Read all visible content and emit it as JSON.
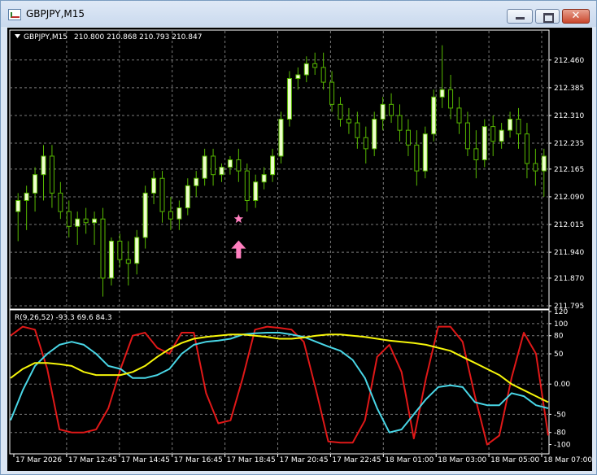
{
  "window": {
    "title": "GBPJPY,M15",
    "close_glyph": "✕",
    "icons": {
      "app": "chart-app-icon",
      "minimize": "minimize-icon",
      "maximize": "maximize-icon",
      "close": "close-icon"
    }
  },
  "chart_header": {
    "symbol_text": "GBPJPY,M15",
    "ohlc_text": "210.800 210.868 210.793 210.847",
    "dropdown_icon": "triangle-down-icon"
  },
  "oscillator_header": {
    "text": "R(9,26,52) -93.3 69.6 84.3"
  },
  "colors": {
    "background": "#000000",
    "grid": "#7a7a7a",
    "candle_bull": "#eeffcc",
    "candle_bear": "#000000",
    "wick": "#57b800",
    "marker": "#ff7fbf",
    "series_red": "#e01818",
    "series_cyan": "#49d6e6",
    "series_yellow": "#f5f50a"
  },
  "chart_data": [
    {
      "type": "candlestick",
      "title": "GBPJPY,M15",
      "y_ticks": [
        "212.460",
        "212.385",
        "212.310",
        "212.235",
        "212.165",
        "212.090",
        "212.015",
        "211.940",
        "211.870",
        "211.795"
      ],
      "ylim": [
        211.795,
        212.53
      ],
      "candles": [
        {
          "o": 212.05,
          "h": 212.1,
          "l": 211.97,
          "c": 212.08
        },
        {
          "o": 212.08,
          "h": 212.12,
          "l": 212.0,
          "c": 212.1
        },
        {
          "o": 212.1,
          "h": 212.17,
          "l": 212.05,
          "c": 212.15
        },
        {
          "o": 212.15,
          "h": 212.23,
          "l": 212.08,
          "c": 212.2
        },
        {
          "o": 212.2,
          "h": 212.23,
          "l": 212.06,
          "c": 212.1
        },
        {
          "o": 212.1,
          "h": 212.13,
          "l": 212.03,
          "c": 212.05
        },
        {
          "o": 212.05,
          "h": 212.08,
          "l": 211.98,
          "c": 212.01
        },
        {
          "o": 212.01,
          "h": 212.05,
          "l": 211.96,
          "c": 212.03
        },
        {
          "o": 212.03,
          "h": 212.06,
          "l": 211.99,
          "c": 212.02
        },
        {
          "o": 212.02,
          "h": 212.05,
          "l": 211.96,
          "c": 212.03
        },
        {
          "o": 212.03,
          "h": 212.06,
          "l": 211.82,
          "c": 211.87
        },
        {
          "o": 211.87,
          "h": 211.98,
          "l": 211.85,
          "c": 211.97
        },
        {
          "o": 211.97,
          "h": 211.99,
          "l": 211.9,
          "c": 211.92
        },
        {
          "o": 211.92,
          "h": 211.97,
          "l": 211.85,
          "c": 211.91
        },
        {
          "o": 211.91,
          "h": 212.0,
          "l": 211.88,
          "c": 211.98
        },
        {
          "o": 211.98,
          "h": 212.12,
          "l": 211.95,
          "c": 212.1
        },
        {
          "o": 212.1,
          "h": 212.16,
          "l": 212.07,
          "c": 212.14
        },
        {
          "o": 212.14,
          "h": 212.16,
          "l": 212.02,
          "c": 212.05
        },
        {
          "o": 212.05,
          "h": 212.09,
          "l": 212.0,
          "c": 212.03
        },
        {
          "o": 212.03,
          "h": 212.08,
          "l": 212.0,
          "c": 212.06
        },
        {
          "o": 212.06,
          "h": 212.14,
          "l": 212.04,
          "c": 212.12
        },
        {
          "o": 212.12,
          "h": 212.16,
          "l": 212.09,
          "c": 212.14
        },
        {
          "o": 212.14,
          "h": 212.22,
          "l": 212.12,
          "c": 212.2
        },
        {
          "o": 212.2,
          "h": 212.22,
          "l": 212.12,
          "c": 212.15
        },
        {
          "o": 212.15,
          "h": 212.18,
          "l": 212.13,
          "c": 212.17
        },
        {
          "o": 212.17,
          "h": 212.2,
          "l": 212.15,
          "c": 212.19
        },
        {
          "o": 212.19,
          "h": 212.22,
          "l": 212.13,
          "c": 212.16
        },
        {
          "o": 212.16,
          "h": 212.18,
          "l": 212.05,
          "c": 212.08
        },
        {
          "o": 212.08,
          "h": 212.15,
          "l": 212.06,
          "c": 212.13
        },
        {
          "o": 212.13,
          "h": 212.17,
          "l": 212.11,
          "c": 212.15
        },
        {
          "o": 212.15,
          "h": 212.22,
          "l": 212.13,
          "c": 212.2
        },
        {
          "o": 212.2,
          "h": 212.32,
          "l": 212.18,
          "c": 212.3
        },
        {
          "o": 212.3,
          "h": 212.43,
          "l": 212.28,
          "c": 212.41
        },
        {
          "o": 212.41,
          "h": 212.44,
          "l": 212.38,
          "c": 212.42
        },
        {
          "o": 212.42,
          "h": 212.47,
          "l": 212.4,
          "c": 212.45
        },
        {
          "o": 212.45,
          "h": 212.48,
          "l": 212.42,
          "c": 212.44
        },
        {
          "o": 212.44,
          "h": 212.48,
          "l": 212.38,
          "c": 212.4
        },
        {
          "o": 212.4,
          "h": 212.43,
          "l": 212.32,
          "c": 212.34
        },
        {
          "o": 212.34,
          "h": 212.36,
          "l": 212.28,
          "c": 212.3
        },
        {
          "o": 212.3,
          "h": 212.33,
          "l": 212.26,
          "c": 212.29
        },
        {
          "o": 212.29,
          "h": 212.32,
          "l": 212.22,
          "c": 212.25
        },
        {
          "o": 212.25,
          "h": 212.28,
          "l": 212.18,
          "c": 212.22
        },
        {
          "o": 212.22,
          "h": 212.32,
          "l": 212.2,
          "c": 212.3
        },
        {
          "o": 212.3,
          "h": 212.36,
          "l": 212.27,
          "c": 212.34
        },
        {
          "o": 212.34,
          "h": 212.37,
          "l": 212.29,
          "c": 212.31
        },
        {
          "o": 212.31,
          "h": 212.34,
          "l": 212.24,
          "c": 212.27
        },
        {
          "o": 212.27,
          "h": 212.3,
          "l": 212.2,
          "c": 212.23
        },
        {
          "o": 212.23,
          "h": 212.27,
          "l": 212.12,
          "c": 212.16
        },
        {
          "o": 212.16,
          "h": 212.28,
          "l": 212.14,
          "c": 212.26
        },
        {
          "o": 212.26,
          "h": 212.38,
          "l": 212.24,
          "c": 212.36
        },
        {
          "o": 212.36,
          "h": 212.5,
          "l": 212.33,
          "c": 212.38
        },
        {
          "o": 212.38,
          "h": 212.42,
          "l": 212.3,
          "c": 212.33
        },
        {
          "o": 212.33,
          "h": 212.36,
          "l": 212.26,
          "c": 212.29
        },
        {
          "o": 212.29,
          "h": 212.32,
          "l": 212.2,
          "c": 212.22
        },
        {
          "o": 212.22,
          "h": 212.27,
          "l": 212.14,
          "c": 212.19
        },
        {
          "o": 212.19,
          "h": 212.3,
          "l": 212.17,
          "c": 212.28
        },
        {
          "o": 212.28,
          "h": 212.31,
          "l": 212.2,
          "c": 212.24
        },
        {
          "o": 212.24,
          "h": 212.29,
          "l": 212.22,
          "c": 212.27
        },
        {
          "o": 212.27,
          "h": 212.32,
          "l": 212.25,
          "c": 212.3
        },
        {
          "o": 212.3,
          "h": 212.33,
          "l": 212.22,
          "c": 212.26
        },
        {
          "o": 212.26,
          "h": 212.29,
          "l": 212.14,
          "c": 212.18
        },
        {
          "o": 212.18,
          "h": 212.22,
          "l": 212.12,
          "c": 212.16
        },
        {
          "o": 212.16,
          "h": 212.22,
          "l": 212.09,
          "c": 212.2
        }
      ],
      "markers": [
        {
          "type": "star",
          "price": 212.03,
          "icon": "star-icon"
        },
        {
          "type": "arrow-up",
          "price": 211.95,
          "icon": "up-arrow-icon"
        }
      ]
    },
    {
      "type": "line",
      "title": "R(9,26,52)",
      "y_ticks": [
        "120",
        "100",
        "80",
        "50",
        "0.00",
        "-50",
        "-80",
        "-100"
      ],
      "ylim": [
        -110,
        120
      ],
      "x_labels": [
        "17 Mar 2026",
        "17 Mar 12:45",
        "17 Mar 14:45",
        "17 Mar 16:45",
        "17 Mar 18:45",
        "17 Mar 20:45",
        "17 Mar 22:45",
        "18 Mar 01:00",
        "18 Mar 03:00",
        "18 Mar 05:00",
        "18 Mar 07:00"
      ],
      "series": [
        {
          "color": "#e01818",
          "values": [
            80,
            95,
            90,
            25,
            -75,
            -80,
            -80,
            -75,
            -40,
            25,
            80,
            85,
            60,
            50,
            85,
            85,
            -15,
            -65,
            -60,
            10,
            90,
            95,
            93,
            90,
            70,
            -10,
            -95,
            -97,
            -97,
            -60,
            45,
            65,
            20,
            -90,
            10,
            95,
            95,
            70,
            -20,
            -100,
            -85,
            10,
            85,
            50,
            -85
          ]
        },
        {
          "color": "#49d6e6",
          "values": [
            -60,
            -10,
            30,
            50,
            65,
            70,
            65,
            50,
            30,
            25,
            10,
            10,
            15,
            25,
            50,
            65,
            70,
            72,
            75,
            82,
            84,
            85,
            85,
            82,
            78,
            70,
            62,
            55,
            40,
            10,
            -40,
            -80,
            -75,
            -50,
            -25,
            -5,
            -2,
            -5,
            -30,
            -35,
            -35,
            -15,
            -20,
            -35,
            -40
          ]
        },
        {
          "color": "#f5f50a",
          "values": [
            10,
            25,
            35,
            35,
            33,
            30,
            20,
            15,
            15,
            15,
            20,
            30,
            45,
            58,
            68,
            75,
            78,
            80,
            82,
            82,
            80,
            78,
            75,
            75,
            77,
            80,
            82,
            82,
            80,
            78,
            75,
            72,
            70,
            68,
            65,
            60,
            55,
            45,
            35,
            25,
            15,
            0,
            -10,
            -20,
            -30
          ]
        }
      ]
    }
  ]
}
